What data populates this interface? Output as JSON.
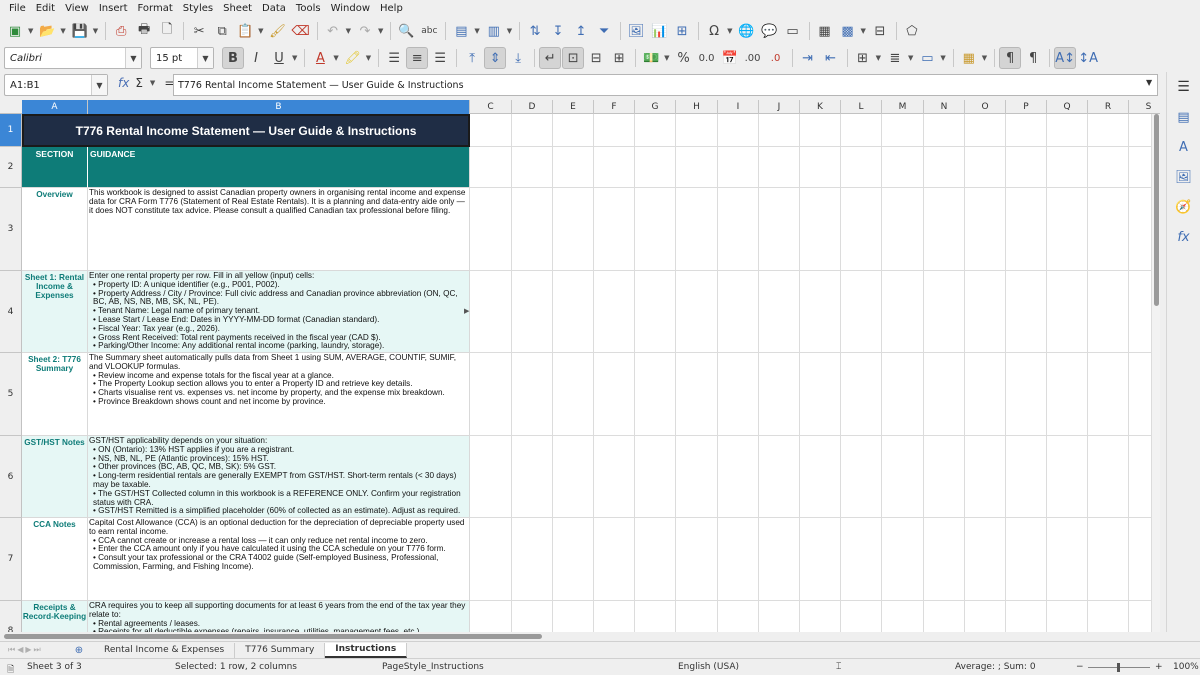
{
  "menu": [
    "File",
    "Edit",
    "View",
    "Insert",
    "Format",
    "Styles",
    "Sheet",
    "Data",
    "Tools",
    "Window",
    "Help"
  ],
  "format_toolbar": {
    "font_name": "Calibri",
    "font_size": "15 pt"
  },
  "formula_bar": {
    "name_box": "A1:B1",
    "content": "T776 Rental Income Statement — User Guide & Instructions"
  },
  "columns": [
    "A",
    "B",
    "C",
    "D",
    "E",
    "F",
    "G",
    "H",
    "I",
    "J",
    "K",
    "L",
    "M",
    "N",
    "O",
    "P",
    "Q",
    "R",
    "S"
  ],
  "rows": [
    "1",
    "2",
    "3",
    "4",
    "5",
    "6",
    "7",
    "8"
  ],
  "sheet": {
    "title": "T776 Rental Income Statement — User Guide & Instructions",
    "header_section": "SECTION",
    "header_guidance": "GUIDANCE",
    "sections": [
      {
        "name": "Overview",
        "lines": [
          "This workbook is designed to assist Canadian property owners in organising rental income and expense data for CRA Form T776 (Statement of Real Estate Rentals). It is a planning and data-entry aide only — it does NOT constitute tax advice. Please consult a qualified Canadian tax professional before filing."
        ]
      },
      {
        "name": "Sheet 1: Rental Income & Expenses",
        "lines": [
          "Enter one rental property per row. Fill in all yellow (input) cells:",
          "  • Property ID: A unique identifier (e.g., P001, P002).",
          "  • Property Address / City / Province: Full civic address and Canadian province abbreviation (ON, QC, BC, AB, NS, NB, MB, SK, NL, PE).",
          "  • Tenant Name: Legal name of primary tenant.",
          "  • Lease Start / Lease End: Dates in YYYY-MM-DD format (Canadian standard).",
          "  • Fiscal Year: Tax year (e.g., 2026).",
          "  • Gross Rent Received: Total rent payments received in the fiscal year (CAD $).",
          "  • Parking/Other Income: Any additional rental income (parking, laundry, storage)."
        ]
      },
      {
        "name": "Sheet 2: T776 Summary",
        "lines": [
          "The Summary sheet automatically pulls data from Sheet 1 using SUM, AVERAGE, COUNTIF, SUMIF, and VLOOKUP formulas.",
          "  • Review income and expense totals for the fiscal year at a glance.",
          "  • The Property Lookup section allows you to enter a Property ID and retrieve key details.",
          "  • Charts visualise rent vs. expenses vs. net income by property, and the expense mix breakdown.",
          "  • Province Breakdown shows count and net income by province."
        ]
      },
      {
        "name": "GST/HST Notes",
        "lines": [
          "GST/HST applicability depends on your situation:",
          "  • ON (Ontario): 13% HST applies if you are a registrant.",
          "  • NS, NB, NL, PE (Atlantic provinces): 15% HST.",
          "  • Other provinces (BC, AB, QC, MB, SK): 5% GST.",
          "  • Long-term residential rentals are generally EXEMPT from GST/HST. Short-term rentals (< 30 days) may be taxable.",
          "  • The GST/HST Collected column in this workbook is a REFERENCE ONLY. Confirm your registration status with CRA.",
          "  • GST/HST Remitted is a simplified placeholder (60% of collected as an estimate). Adjust as required."
        ]
      },
      {
        "name": "CCA Notes",
        "lines": [
          "Capital Cost Allowance (CCA) is an optional deduction for the depreciation of depreciable property used to earn rental income.",
          "  • CCA cannot create or increase a rental loss — it can only reduce net rental income to zero.",
          "  • Enter the CCA amount only if you have calculated it using the CCA schedule on your T776 form.",
          "  • Consult your tax professional or the CRA T4002 guide (Self-employed Business, Professional, Commission, Farming, and Fishing Income)."
        ]
      },
      {
        "name": "Receipts & Record-Keeping",
        "lines": [
          "CRA requires you to keep all supporting documents for at least 6 years from the end of the tax year they relate to:",
          "  • Rental agreements / leases.",
          "  • Receipts for all deductible expenses (repairs, insurance, utilities, management fees, etc.)"
        ]
      }
    ]
  },
  "sheet_tabs": [
    "Rental Income & Expenses",
    "T776 Summary",
    "Instructions"
  ],
  "active_tab": "Instructions",
  "status": {
    "sheet": "Sheet 3 of 3",
    "selection": "Selected: 1 row, 2 columns",
    "page_style": "PageStyle_Instructions",
    "language": "English (USA)",
    "sum": "Average: ; Sum: 0",
    "zoom": "100%"
  },
  "colors": {
    "title_bg": "#1f2d45",
    "header_bg": "#0e7c78",
    "section_text": "#0e7c78",
    "alt_row_bg": "#e6f7f5",
    "selection": "#3b86d6"
  }
}
